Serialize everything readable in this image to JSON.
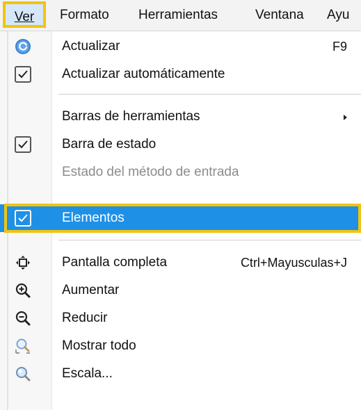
{
  "menubar": {
    "items": [
      {
        "label": "Ver"
      },
      {
        "label": "Formato"
      },
      {
        "label": "Herramientas"
      },
      {
        "label": "Ventana"
      },
      {
        "label": "Ayu"
      }
    ]
  },
  "menu": {
    "items": [
      {
        "label": "Actualizar",
        "shortcut": "F9",
        "icon": "refresh-icon"
      },
      {
        "label": "Actualizar automáticamente",
        "checked": true
      },
      {
        "label": "Barras de herramientas",
        "submenu": true
      },
      {
        "label": "Barra de estado",
        "checked": true
      },
      {
        "label": "Estado del método de entrada",
        "disabled": true
      },
      {
        "label": "Elementos",
        "checked": true,
        "highlighted": true
      },
      {
        "label": "Pantalla completa",
        "shortcut": "Ctrl+Mayusculas+J",
        "icon": "fullscreen-icon"
      },
      {
        "label": "Aumentar",
        "icon": "zoom-in-icon"
      },
      {
        "label": "Reducir",
        "icon": "zoom-out-icon"
      },
      {
        "label": "Mostrar todo",
        "icon": "show-all-icon"
      },
      {
        "label": "Escala...",
        "icon": "scale-icon"
      }
    ]
  },
  "colors": {
    "highlight": "#1e90e6",
    "annotation": "#f1c40f",
    "menu_background": "#ffffff",
    "disabled_text": "#8c8c8c"
  }
}
